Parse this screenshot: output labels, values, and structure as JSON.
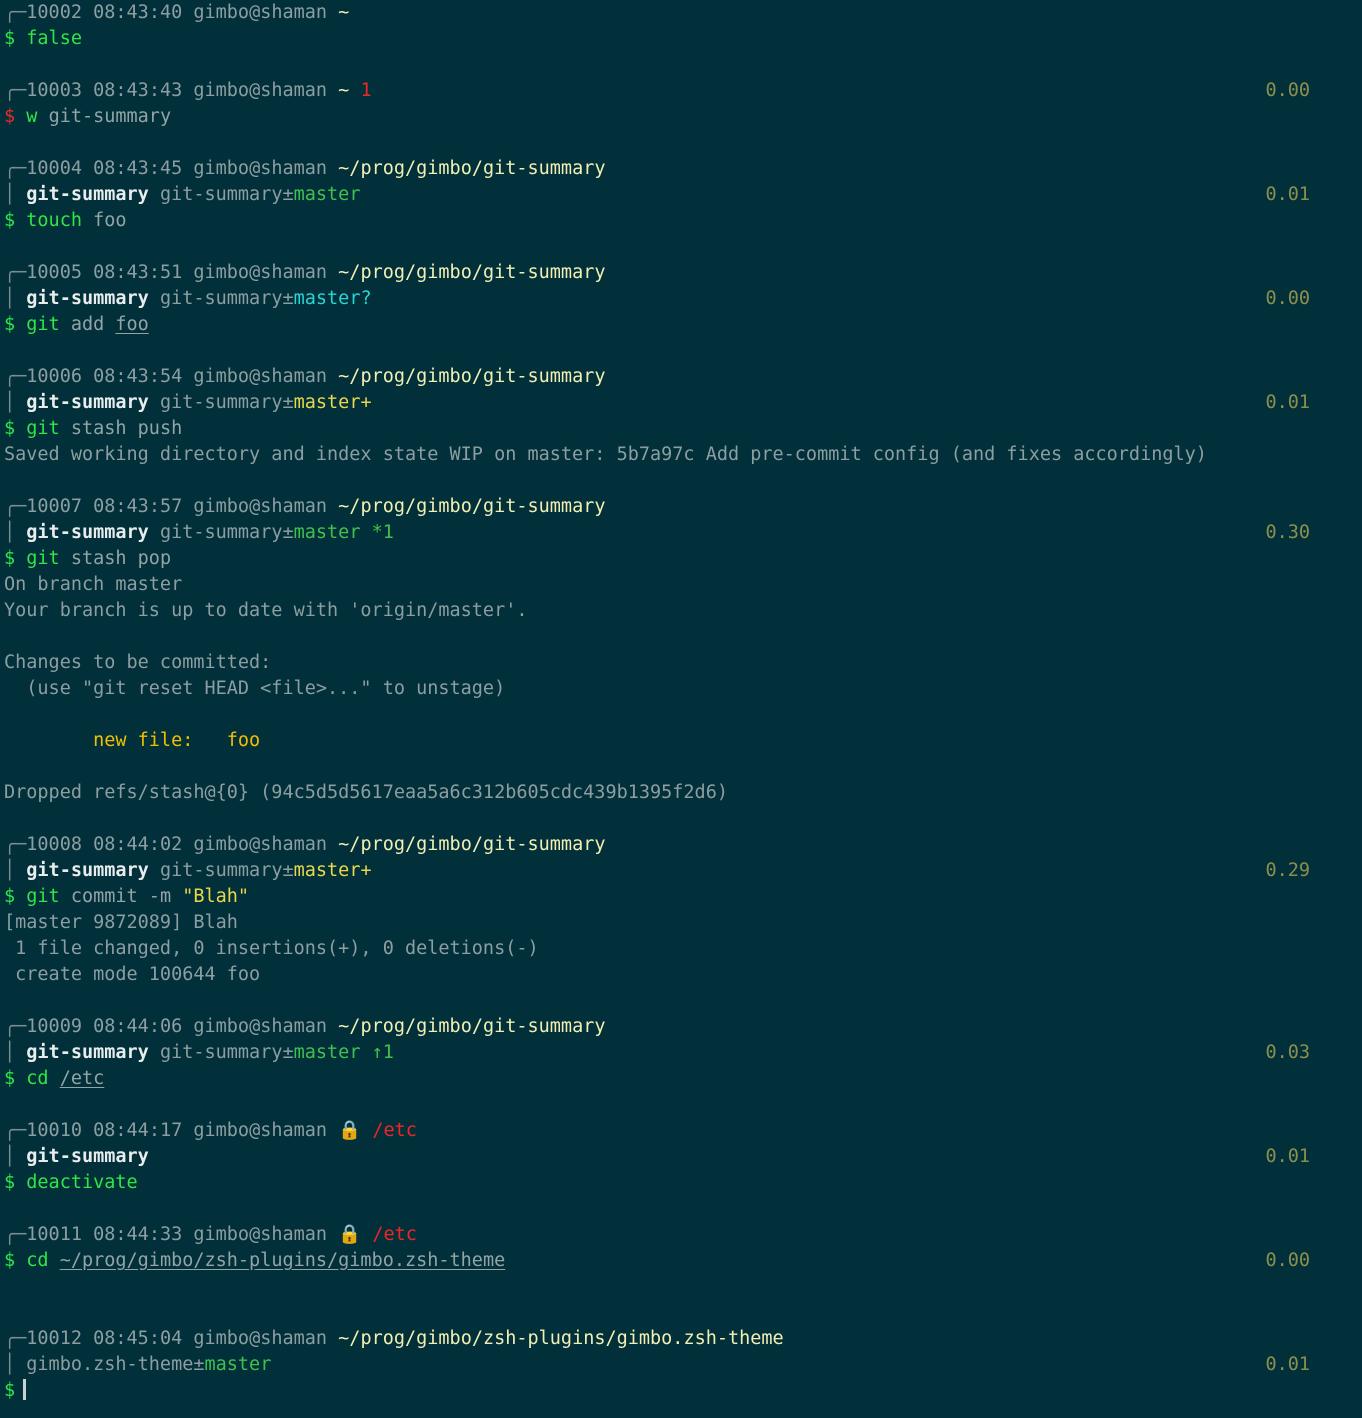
{
  "terminal": {
    "background": "#02303a",
    "foreground": "#a6b2b4",
    "user_host": "gimbo@shaman",
    "prompt_char": "$",
    "cursor_char": "▏"
  },
  "colors": {
    "green": "#2fe548",
    "red": "#e52b2b",
    "yellow": "#e8d84a",
    "gold": "#f0c000",
    "path": "#f2efb4",
    "cyan": "#2ad4d4",
    "gray": "#8c9ea1",
    "duration": "#8a8f4e",
    "lock": "#f5c518",
    "white": "#e8eced"
  },
  "glyphs": {
    "corner": "╭─",
    "bar": "│",
    "tilde": "~",
    "plusminus": "±",
    "lock": "🔒",
    "stash": "*",
    "ahead": "↑"
  },
  "entries": [
    {
      "id": "10002",
      "time": "08:43:40",
      "user_host": "gimbo@shaman",
      "path": "~",
      "exit_code": "",
      "duration": "",
      "venv": "",
      "repo": "",
      "branch": "",
      "flags": "",
      "prompt_status": "ok",
      "command": "false",
      "command_args": "",
      "output": []
    },
    {
      "id": "10003",
      "time": "08:43:43",
      "user_host": "gimbo@shaman",
      "path": "~",
      "exit_code": "1",
      "duration": "0.00",
      "venv": "",
      "repo": "",
      "branch": "",
      "flags": "",
      "prompt_status": "error",
      "command": "w",
      "command_args": "git-summary",
      "output": []
    },
    {
      "id": "10004",
      "time": "08:43:45",
      "user_host": "gimbo@shaman",
      "path": "~/prog/gimbo/git-summary",
      "exit_code": "",
      "duration": "0.01",
      "venv": "git-summary",
      "repo": "git-summary",
      "branch": "master",
      "flags": "",
      "prompt_status": "ok",
      "command": "touch",
      "command_args": "foo",
      "output": []
    },
    {
      "id": "10005",
      "time": "08:43:51",
      "user_host": "gimbo@shaman",
      "path": "~/prog/gimbo/git-summary",
      "exit_code": "",
      "duration": "0.00",
      "venv": "git-summary",
      "repo": "git-summary",
      "branch": "master?",
      "flags": "",
      "prompt_status": "ok",
      "command": "git",
      "command_args": "add foo",
      "output": []
    },
    {
      "id": "10006",
      "time": "08:43:54",
      "user_host": "gimbo@shaman",
      "path": "~/prog/gimbo/git-summary",
      "exit_code": "",
      "duration": "0.01",
      "venv": "git-summary",
      "repo": "git-summary",
      "branch": "master+",
      "flags": "",
      "prompt_status": "ok",
      "command": "git",
      "command_args": "stash push",
      "output": [
        "Saved working directory and index state WIP on master: 5b7a97c Add pre-commit config (and fixes accordingly)"
      ]
    },
    {
      "id": "10007",
      "time": "08:43:57",
      "user_host": "gimbo@shaman",
      "path": "~/prog/gimbo/git-summary",
      "exit_code": "",
      "duration": "0.30",
      "venv": "git-summary",
      "repo": "git-summary",
      "branch": "master",
      "flags": "*1",
      "prompt_status": "ok",
      "command": "git",
      "command_args": "stash pop",
      "output": [
        "On branch master",
        "Your branch is up to date with 'origin/master'.",
        "",
        "Changes to be committed:",
        "  (use \"git reset HEAD <file>...\" to unstage)",
        "",
        "        new file:   foo",
        "",
        "Dropped refs/stash@{0} (94c5d5d5617eaa5a6c312b605cdc439b1395f2d6)"
      ]
    },
    {
      "id": "10008",
      "time": "08:44:02",
      "user_host": "gimbo@shaman",
      "path": "~/prog/gimbo/git-summary",
      "exit_code": "",
      "duration": "0.29",
      "venv": "git-summary",
      "repo": "git-summary",
      "branch": "master+",
      "flags": "",
      "prompt_status": "ok",
      "command": "git",
      "command_args": "commit -m \"Blah\"",
      "output": [
        "[master 9872089] Blah",
        " 1 file changed, 0 insertions(+), 0 deletions(-)",
        " create mode 100644 foo"
      ]
    },
    {
      "id": "10009",
      "time": "08:44:06",
      "user_host": "gimbo@shaman",
      "path": "~/prog/gimbo/git-summary",
      "exit_code": "",
      "duration": "0.03",
      "venv": "git-summary",
      "repo": "git-summary",
      "branch": "master",
      "flags": "↑1",
      "prompt_status": "ok",
      "command": "cd",
      "command_args": "/etc",
      "output": []
    },
    {
      "id": "10010",
      "time": "08:44:17",
      "user_host": "gimbo@shaman",
      "path": "/etc",
      "path_locked": true,
      "exit_code": "",
      "duration": "0.01",
      "venv": "git-summary",
      "repo": "",
      "branch": "",
      "flags": "",
      "prompt_status": "ok",
      "command": "deactivate",
      "command_args": "",
      "output": []
    },
    {
      "id": "10011",
      "time": "08:44:33",
      "user_host": "gimbo@shaman",
      "path": "/etc",
      "path_locked": true,
      "exit_code": "",
      "duration": "0.00",
      "venv": "",
      "repo": "",
      "branch": "",
      "flags": "",
      "prompt_status": "ok",
      "command": "cd",
      "command_args": "~/prog/gimbo/zsh-plugins/gimbo.zsh-theme",
      "output": []
    },
    {
      "id": "10012",
      "time": "08:45:04",
      "user_host": "gimbo@shaman",
      "path": "~/prog/gimbo/zsh-plugins/gimbo.zsh-theme",
      "exit_code": "",
      "duration": "0.01",
      "venv": "",
      "repo": "gimbo.zsh-theme",
      "branch": "master",
      "flags": "",
      "prompt_status": "ok",
      "command": "",
      "command_args": "",
      "output": [],
      "active": true
    }
  ]
}
